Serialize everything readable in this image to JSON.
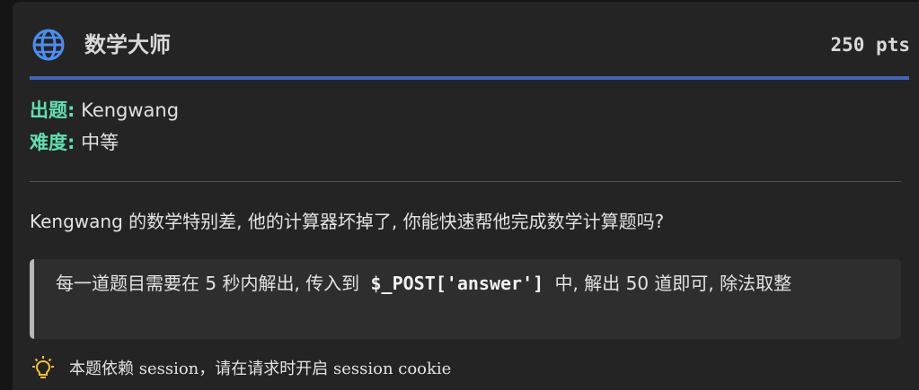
{
  "challenge": {
    "title": "数学大师",
    "points": "250 pts",
    "author_label": "出题:",
    "author": "Kengwang",
    "difficulty_label": "难度:",
    "difficulty": "中等",
    "description": "Kengwang 的数学特别差, 他的计算器坏掉了, 你能快速帮他完成数学计算题吗?",
    "note": {
      "before": "每一道题目需要在 5 秒内解出, 传入到",
      "code": "$_POST['answer']",
      "after": "中, 解出 50 道即可, 除法取整"
    },
    "hint": "本题依赖 session，请在请求时开启 session cookie"
  },
  "colors": {
    "accent": "#3c66b8",
    "meta_label": "#5fe0b0",
    "icon_blue": "#4a8ef0",
    "bulb_yellow": "#f4c430"
  },
  "icons": {
    "category": "globe-icon",
    "hint": "lightbulb-icon"
  }
}
